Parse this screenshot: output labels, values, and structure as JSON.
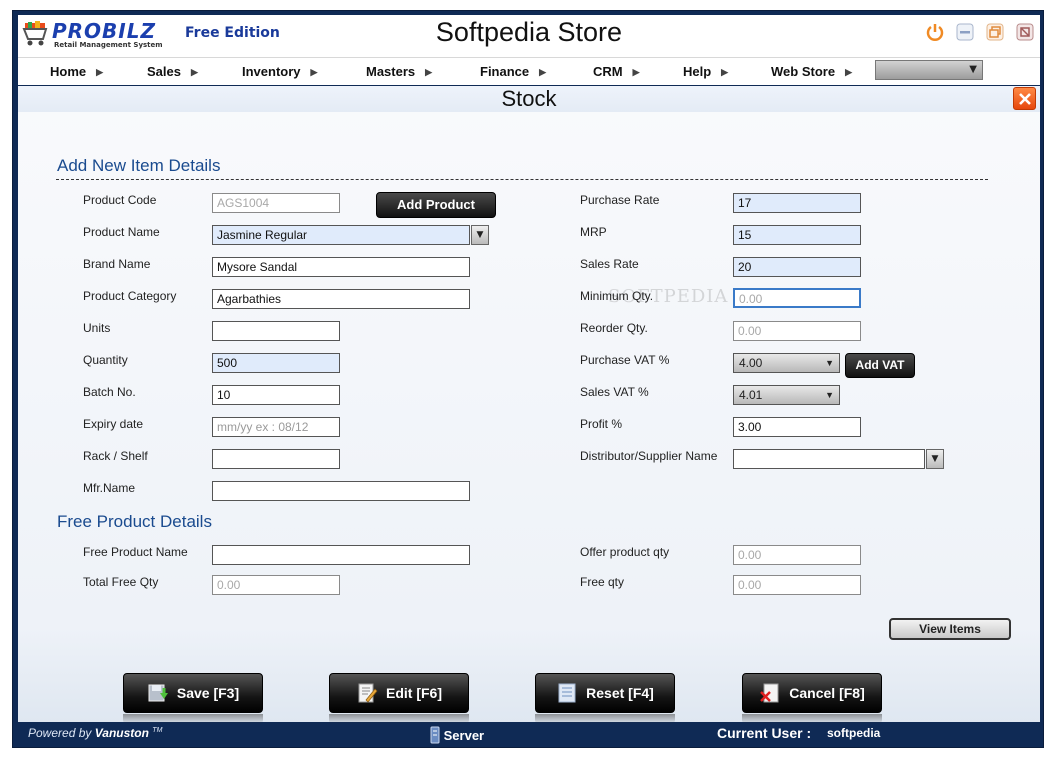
{
  "header": {
    "logo_text": "PROBILZ",
    "logo_sub": "Retail Management System",
    "edition": "Free Edition",
    "title": "Softpedia Store"
  },
  "menu": {
    "items": [
      "Home",
      "Sales",
      "Inventory",
      "Masters",
      "Finance",
      "CRM",
      "Help",
      "Web Store"
    ],
    "selector_value": ""
  },
  "page": {
    "title": "Stock"
  },
  "add_item": {
    "section_title": "Add New Item Details",
    "product_code": {
      "label": "Product Code",
      "value": "AGS1004"
    },
    "add_product_label": "Add Product",
    "product_name": {
      "label": "Product Name",
      "value": "Jasmine Regular"
    },
    "brand_name": {
      "label": "Brand Name",
      "value": "Mysore Sandal"
    },
    "product_category": {
      "label": "Product Category",
      "value": "Agarbathies"
    },
    "units": {
      "label": "Units",
      "value": ""
    },
    "quantity": {
      "label": "Quantity",
      "value": "500"
    },
    "batch_no": {
      "label": "Batch No.",
      "value": "10"
    },
    "expiry_date": {
      "label": "Expiry date",
      "placeholder": "mm/yy  ex : 08/12"
    },
    "rack_shelf": {
      "label": "Rack / Shelf",
      "value": ""
    },
    "mfr_name": {
      "label": "Mfr.Name",
      "value": ""
    },
    "purchase_rate": {
      "label": "Purchase Rate",
      "value": "17"
    },
    "mrp": {
      "label": "MRP",
      "value": "15"
    },
    "sales_rate": {
      "label": "Sales Rate",
      "value": "20"
    },
    "minimum_qty": {
      "label": "Minimum Qty.",
      "value": "0.00"
    },
    "reorder_qty": {
      "label": "Reorder Qty.",
      "value": "0.00"
    },
    "purchase_vat": {
      "label": "Purchase VAT %",
      "value": "4.00"
    },
    "add_vat_label": "Add VAT",
    "sales_vat": {
      "label": "Sales VAT %",
      "value": "4.01"
    },
    "profit": {
      "label": "Profit %",
      "value": "3.00"
    },
    "distributor": {
      "label": "Distributor/Supplier Name",
      "value": ""
    }
  },
  "free_product": {
    "section_title": "Free Product Details",
    "free_product_name": {
      "label": "Free Product Name",
      "value": ""
    },
    "total_free_qty": {
      "label": "Total Free Qty",
      "value": "0.00"
    },
    "offer_product_qty": {
      "label": "Offer product qty",
      "value": "0.00"
    },
    "free_qty": {
      "label": "Free qty",
      "value": "0.00"
    }
  },
  "view_items_label": "View  Items",
  "actions": {
    "save": "Save [F3]",
    "edit": "Edit [F6]",
    "reset": "Reset [F4]",
    "cancel": "Cancel [F8]"
  },
  "footer": {
    "powered_prefix": "Powered by",
    "powered_brand": "Vanuston",
    "tm": "TM",
    "server": "Server",
    "current_user_label": "Current User :",
    "current_user": "softpedia"
  },
  "watermark": "SOFTPEDIA",
  "colors": {
    "accent": "#1a4b8f",
    "frame": "#0f2a55",
    "close": "#e6470d",
    "field_blue": "#e0ebfb"
  }
}
